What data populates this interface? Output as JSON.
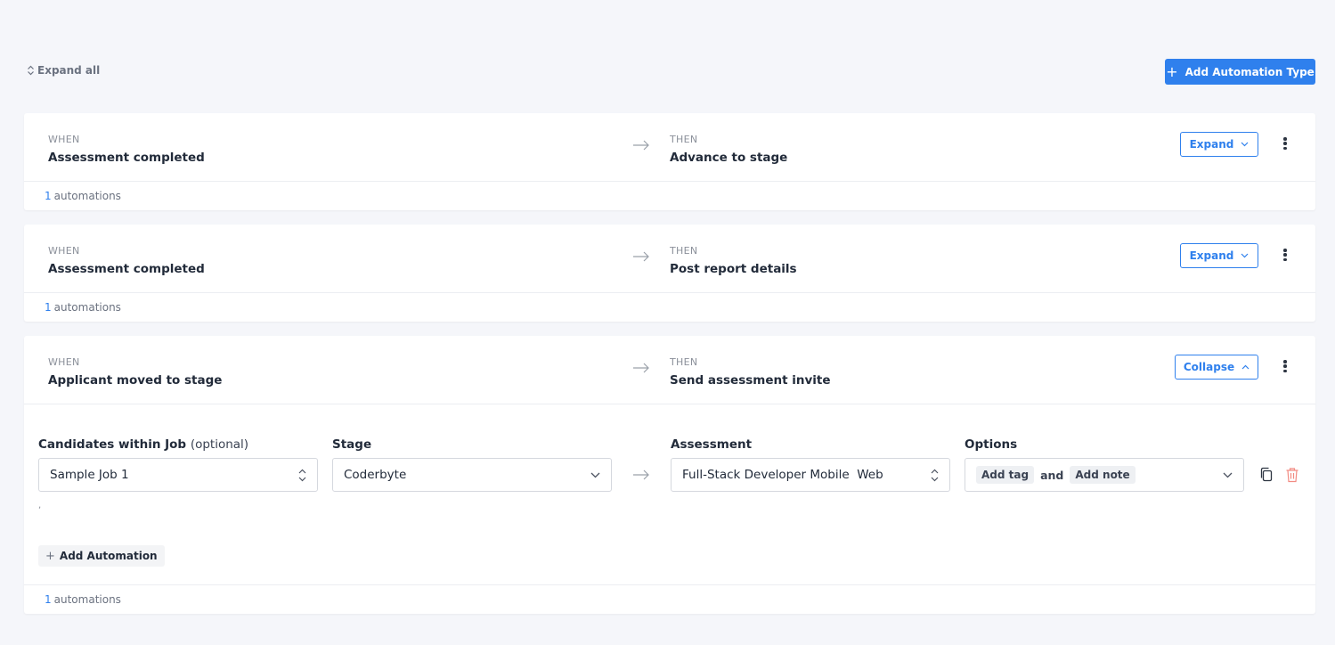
{
  "toolbar": {
    "expand_all": "Expand all",
    "add_type": "Add Automation Type"
  },
  "colors": {
    "accent": "#2f80ed",
    "danger": "#f28b82"
  },
  "cards": [
    {
      "when_label": "WHEN",
      "when": "Assessment completed",
      "then_label": "THEN",
      "then": "Advance to stage",
      "toggle": "Expand",
      "count": "1",
      "count_label": "automations"
    },
    {
      "when_label": "WHEN",
      "when": "Assessment completed",
      "then_label": "THEN",
      "then": "Post report details",
      "toggle": "Expand",
      "count": "1",
      "count_label": "automations"
    },
    {
      "when_label": "WHEN",
      "when": "Applicant moved to stage",
      "then_label": "THEN",
      "then": "Send assessment invite",
      "toggle": "Collapse",
      "count": "1",
      "count_label": "automations",
      "rule": {
        "job_label": "Candidates within Job",
        "job_optional": "(optional)",
        "job_value": "Sample Job 1",
        "stage_label": "Stage",
        "stage_value": "Coderbyte",
        "assessment_label": "Assessment",
        "assessment_value": "Full-Stack Developer Mobile  Web",
        "options_label": "Options",
        "option_tag": "Add tag",
        "option_and": "and",
        "option_note": "Add note",
        "tick": ",",
        "add_automation": "Add Automation"
      }
    }
  ]
}
